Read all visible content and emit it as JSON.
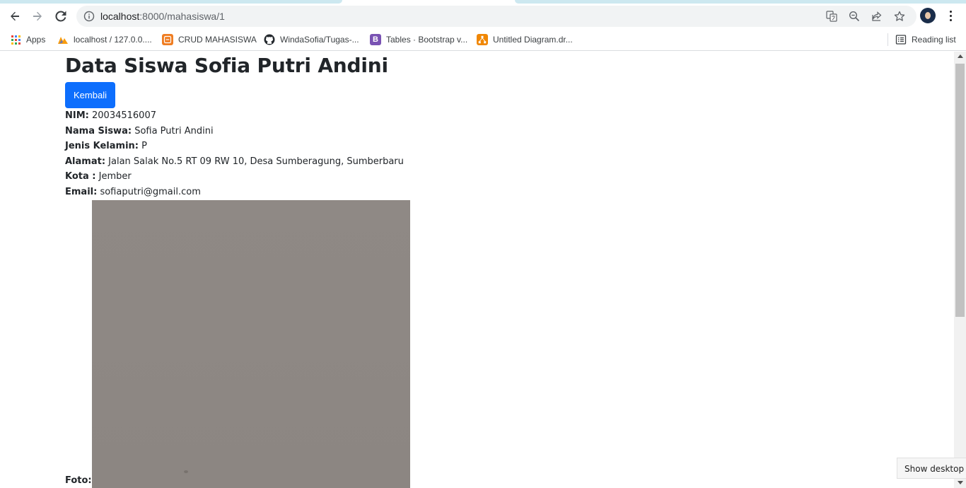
{
  "browser": {
    "url_host": "localhost",
    "url_path": ":8000/mahasiswa/1",
    "bookmarks": [
      {
        "label": "Apps",
        "icon": "apps-grid-icon"
      },
      {
        "label": "localhost / 127.0.0....",
        "icon": "phpmyadmin-icon",
        "color": "#f89c0e"
      },
      {
        "label": "CRUD MAHASISWA",
        "icon": "crud-icon",
        "color": "#ef7d22"
      },
      {
        "label": "WindaSofia/Tugas-...",
        "icon": "github-icon",
        "color": "#24292e"
      },
      {
        "label": "Tables · Bootstrap v...",
        "icon": "bootstrap-icon",
        "color": "#7952b3"
      },
      {
        "label": "Untitled Diagram.dr...",
        "icon": "drawio-icon",
        "color": "#f08705"
      }
    ],
    "reading_list": "Reading list"
  },
  "page": {
    "title": "Data Siswa Sofia Putri Andini",
    "back_button": "Kembali",
    "fields": [
      {
        "label": "NIM:",
        "value": "20034516007"
      },
      {
        "label": "Nama Siswa:",
        "value": "Sofia Putri Andini"
      },
      {
        "label": "Jenis Kelamin:",
        "value": "P"
      },
      {
        "label": "Alamat:",
        "value": "Jalan Salak No.5 RT 09 RW 10, Desa Sumberagung, Sumberbaru"
      },
      {
        "label": "Kota :",
        "value": "Jember"
      },
      {
        "label": "Email:",
        "value": "sofiaputri@gmail.com"
      }
    ],
    "photo_label": "Foto:"
  },
  "tooltip": "Show desktop",
  "colors": {
    "primary_button": "#0d6efd",
    "photo_gray": "#8e8884"
  }
}
